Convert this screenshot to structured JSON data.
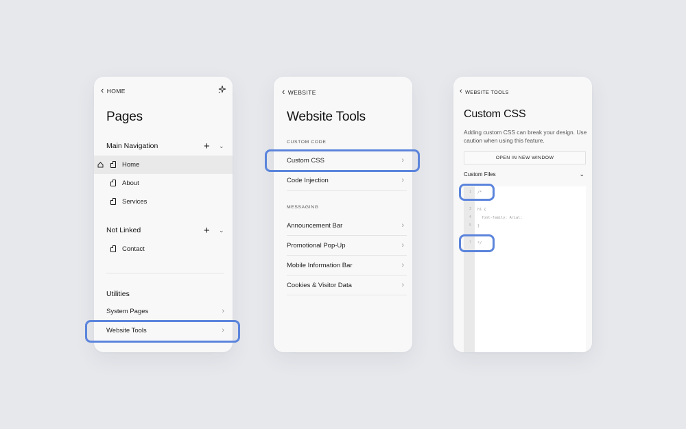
{
  "pages_panel": {
    "back_label": "HOME",
    "title": "Pages",
    "main_nav": {
      "heading": "Main Navigation",
      "items": [
        {
          "label": "Home"
        },
        {
          "label": "About"
        },
        {
          "label": "Services"
        }
      ]
    },
    "not_linked": {
      "heading": "Not Linked",
      "items": [
        {
          "label": "Contact"
        }
      ]
    },
    "utilities": {
      "heading": "Utilities",
      "items": [
        {
          "label": "System Pages"
        },
        {
          "label": "Website Tools"
        }
      ]
    }
  },
  "website_tools_panel": {
    "back_label": "WEBSITE",
    "title": "Website Tools",
    "custom_code": {
      "heading": "CUSTOM CODE",
      "items": [
        {
          "label": "Custom CSS"
        },
        {
          "label": "Code Injection"
        }
      ]
    },
    "messaging": {
      "heading": "MESSAGING",
      "items": [
        {
          "label": "Announcement Bar"
        },
        {
          "label": "Promotional Pop-Up"
        },
        {
          "label": "Mobile Information Bar"
        },
        {
          "label": "Cookies & Visitor Data"
        }
      ]
    }
  },
  "custom_css_panel": {
    "back_label": "WEBSITE TOOLS",
    "title": "Custom CSS",
    "warning": "Adding custom CSS can break your design. Use caution when using this feature.",
    "open_button": "OPEN IN NEW WINDOW",
    "custom_files_label": "Custom Files",
    "code_lines": [
      {
        "n": "1",
        "text": "/*"
      },
      {
        "n": "3",
        "text": "h1 {"
      },
      {
        "n": "4",
        "text": "font-family: Arial;"
      },
      {
        "n": "5",
        "text": "}"
      },
      {
        "n": "7",
        "text": "*/"
      }
    ]
  },
  "colors": {
    "background": "#e6e8ec",
    "panel": "#f8f8f8",
    "highlight": "#5b84dc",
    "selected_row": "#e9e9e9"
  }
}
